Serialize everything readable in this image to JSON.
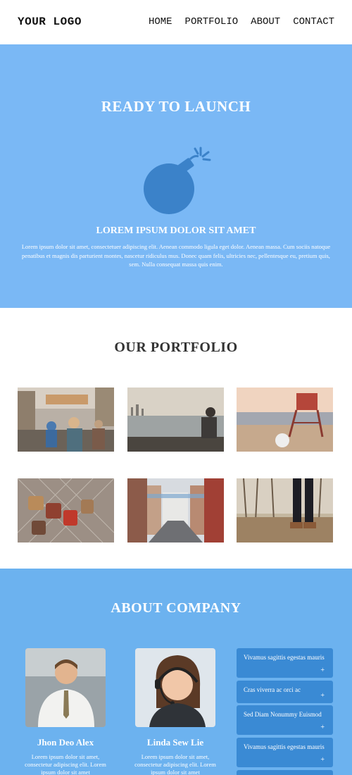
{
  "header": {
    "logo": "YOUR LOGO",
    "nav": [
      "HOME",
      "PORTFOLIO",
      "ABOUT",
      "CONTACT"
    ]
  },
  "hero": {
    "title": "READY TO LAUNCH",
    "icon": "bomb-icon",
    "subtitle": "LOREM IPSUM DOLOR SIT AMET",
    "text": "Lorem ipsum dolor sit amet, consectetuer adipiscing elit. Aenean commodo ligula eget dolor. Aenean massa. Cum sociis natoque penatibus et magnis dis parturient montes, nascetur ridiculus mus. Donec quam felis, ultricies nec, pellentesque eu, pretium quis, sem. Nulla consequat massa quis enim."
  },
  "portfolio": {
    "title": "OUR PORTFOLIO"
  },
  "about": {
    "title": "ABOUT COMPANY",
    "people": [
      {
        "name": "Jhon Deo Alex",
        "text": "Lorem ipsum dolor sit amet, consectetur adipiscing elit. Lorem ipsum dolor sit amet"
      },
      {
        "name": "Linda Sew Lie",
        "text": "Lorem ipsum dolor sit amet, consectetur adipiscing elit. Lorem ipsum dolor sit amet"
      }
    ],
    "accordion": [
      {
        "label": "Vivamus sagittis egestas mauris",
        "icon": "+"
      },
      {
        "label": "Cras viverra ac orci ac",
        "icon": "+"
      },
      {
        "label": "Sed Diam Nonummy Euismod",
        "icon": "+"
      },
      {
        "label": "Vivamus sagittis egestas mauris",
        "icon": "+"
      }
    ]
  },
  "colors": {
    "hero_bg": "#7ab8f5",
    "about_bg": "#6cb2ef",
    "accordion_bg": "#3a8ad4",
    "bomb": "#3b82c9"
  }
}
